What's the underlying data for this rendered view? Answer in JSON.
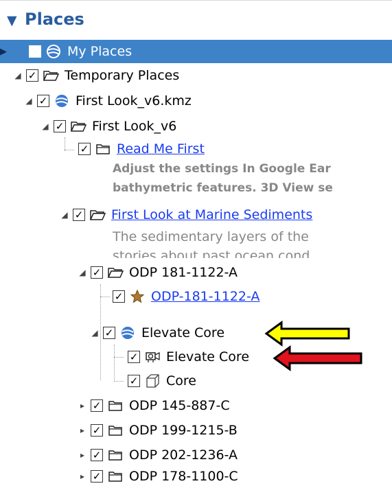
{
  "panel": {
    "title": "Places",
    "expand_glyph": "▼"
  },
  "tree": {
    "my_places": "My Places",
    "temporary_places": "Temporary Places",
    "kmz": "First Look_v6.kmz",
    "folder_v6": "First Look_v6",
    "read_me": "Read Me First",
    "read_me_desc_1": "Adjust the settings In Google Ear",
    "read_me_desc_2": "bathymetric features. 3D View se",
    "marine": "First Look at Marine Sediments",
    "marine_desc_1": "The sedimentary layers of the",
    "marine_desc_2": "stories about past ocean cond",
    "odp_181_folder": "ODP 181-1122-A",
    "odp_181_link": "ODP-181-1122-A",
    "elevate_core_group": "Elevate Core",
    "elevate_core_tour": "Elevate Core",
    "core": "Core",
    "odp_145": "ODP 145-887-C",
    "odp_199": "ODP 199-1215-B",
    "odp_202": "ODP 202-1236-A",
    "odp_178": "ODP 178-1100-C"
  },
  "colors": {
    "header_text": "#2a5d9f",
    "selected_row": "#3e83c8",
    "link": "#1a3cf0",
    "yellow_arrow": "#ffff00",
    "red_arrow": "#e0141e"
  }
}
